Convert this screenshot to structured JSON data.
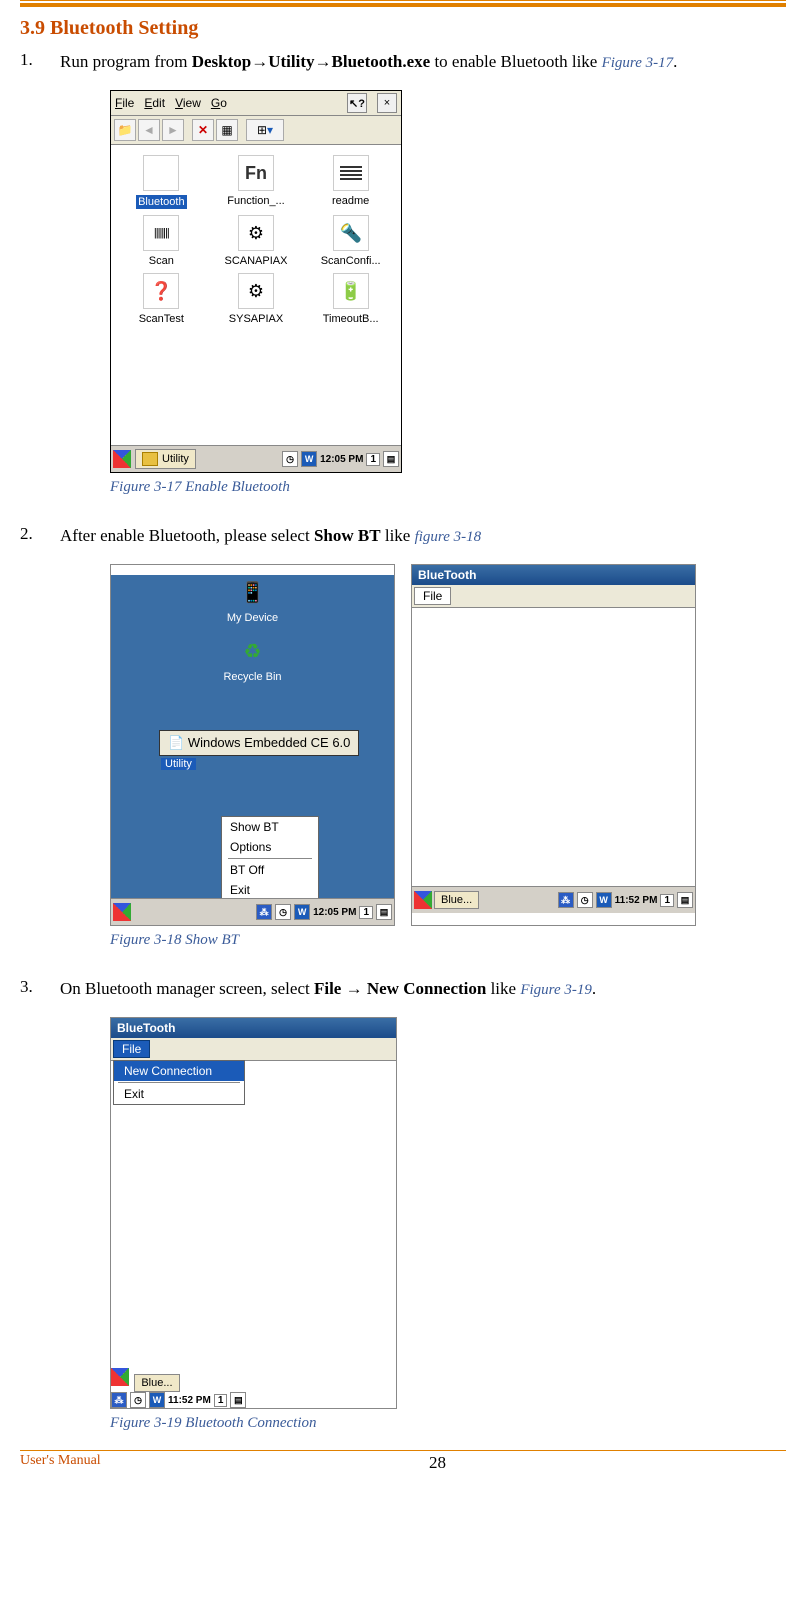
{
  "section": {
    "number": "3.9",
    "title": "Bluetooth Setting"
  },
  "steps": {
    "s1": {
      "num": "1.",
      "pre": "Run program from ",
      "path": "Desktop→Utility→Bluetooth.exe",
      "post": " to enable Bluetooth like ",
      "figref": "Figure 3-17",
      "dot": "."
    },
    "s2": {
      "num": "2.",
      "pre": "After enable Bluetooth, please select ",
      "bold": "Show BT",
      "post": "  like ",
      "figref": "figure 3-18"
    },
    "s3": {
      "num": "3.",
      "pre": "On Bluetooth manager screen, select ",
      "b1": "File",
      "arrow": " → ",
      "b2": "New Connection",
      "post": " like ",
      "figref": "Figure 3-19",
      "dot": "."
    }
  },
  "captions": {
    "c1": "Figure 3-17 Enable Bluetooth",
    "c2": "Figure 3-18 Show BT",
    "c3": "Figure 3-19 Bluetooth Connection"
  },
  "shot1": {
    "menu": {
      "file": "File",
      "edit": "Edit",
      "view": "View",
      "go": "Go",
      "help": "?",
      "close": "×"
    },
    "tb": {
      "back": "◄",
      "fwd": "►",
      "up": "▲",
      "del": "✕",
      "prop": "▦",
      "view": "⊞",
      "dd": "▾"
    },
    "icons": {
      "bluetooth": "Bluetooth",
      "function": "Function_...",
      "readme": "readme",
      "scan": "Scan",
      "scanapiax": "SCANAPIAX",
      "scanconfi": "ScanConfi...",
      "scantest": "ScanTest",
      "sysapiax": "SYSAPIAX",
      "timeout": "TimeoutB..."
    },
    "fn": "Fn",
    "taskbar": {
      "utility": "Utility",
      "time": "12:05 PM",
      "w": "W",
      "n": "1"
    }
  },
  "shot2": {
    "left": {
      "mydevice": "My Device",
      "recycle": "Recycle Bin",
      "link": "Windows Embedded CE 6.0",
      "util": "Utility",
      "menu": {
        "showbt": "Show BT",
        "options": "Options",
        "btoff": "BT Off",
        "exit": "Exit"
      },
      "time": "12:05 PM",
      "n": "1"
    },
    "right": {
      "title": "BlueTooth",
      "file": "File",
      "task": "Blue...",
      "time": "11:52 PM",
      "w": "W",
      "n": "1"
    }
  },
  "shot3": {
    "title": "BlueTooth",
    "file": "File",
    "menu": {
      "newconn": "New Connection",
      "exit": "Exit"
    },
    "task": "Blue...",
    "time": "11:52 PM",
    "w": "W",
    "n": "1"
  },
  "footer": {
    "manual": "User's Manual",
    "page": "28"
  }
}
